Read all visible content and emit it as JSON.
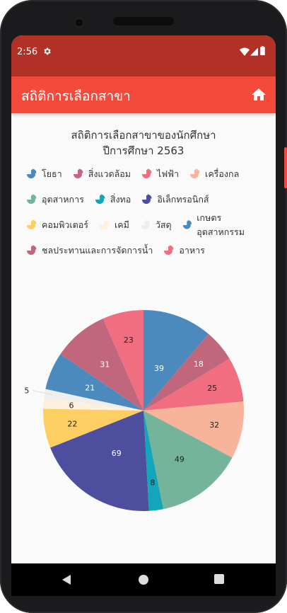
{
  "status_bar": {
    "time": "2:56"
  },
  "app_bar": {
    "title": "สถิติการเลือกสาขา"
  },
  "chart_data": {
    "type": "pie",
    "title_line1": "สถิติการเลือกสาขาของนักศึกษา",
    "title_line2": "ปีการศึกษา 2563",
    "legend_placement": "top",
    "slices": [
      {
        "label": "โยธา",
        "value": 39,
        "color": "#4c89bd"
      },
      {
        "label": "สิ่งแวดล้อม",
        "value": 18,
        "color": "#c0677e"
      },
      {
        "label": "ไฟฟ้า",
        "value": 25,
        "color": "#f16e80"
      },
      {
        "label": "เครื่องกล",
        "value": 32,
        "color": "#f8b39b"
      },
      {
        "label": "อุตสาหการ",
        "value": 49,
        "color": "#74b49b"
      },
      {
        "label": "สิ่งทอ",
        "value": 8,
        "color": "#13a5b8"
      },
      {
        "label": "อิเล็กทรอนิกส์",
        "value": 69,
        "color": "#4d4e9e"
      },
      {
        "label": "คอมพิวเตอร์",
        "value": 22,
        "color": "#fdcf62"
      },
      {
        "label": "เคมี",
        "value": 6,
        "color": "#fdf0df"
      },
      {
        "label": "วัสดุ",
        "value": 5,
        "color": "#eeeeee"
      },
      {
        "label": "เกษตรอุตสาหกรรม",
        "value": 21,
        "color": "#4c89bd"
      },
      {
        "label": "ชลประทานและการจัดการน้ำ",
        "value": 31,
        "color": "#c0677e"
      },
      {
        "label": "อาหาร",
        "value": 23,
        "color": "#f16e80"
      }
    ],
    "label_colors": {
      "light": "#ffffff",
      "dark": "#222222"
    }
  }
}
